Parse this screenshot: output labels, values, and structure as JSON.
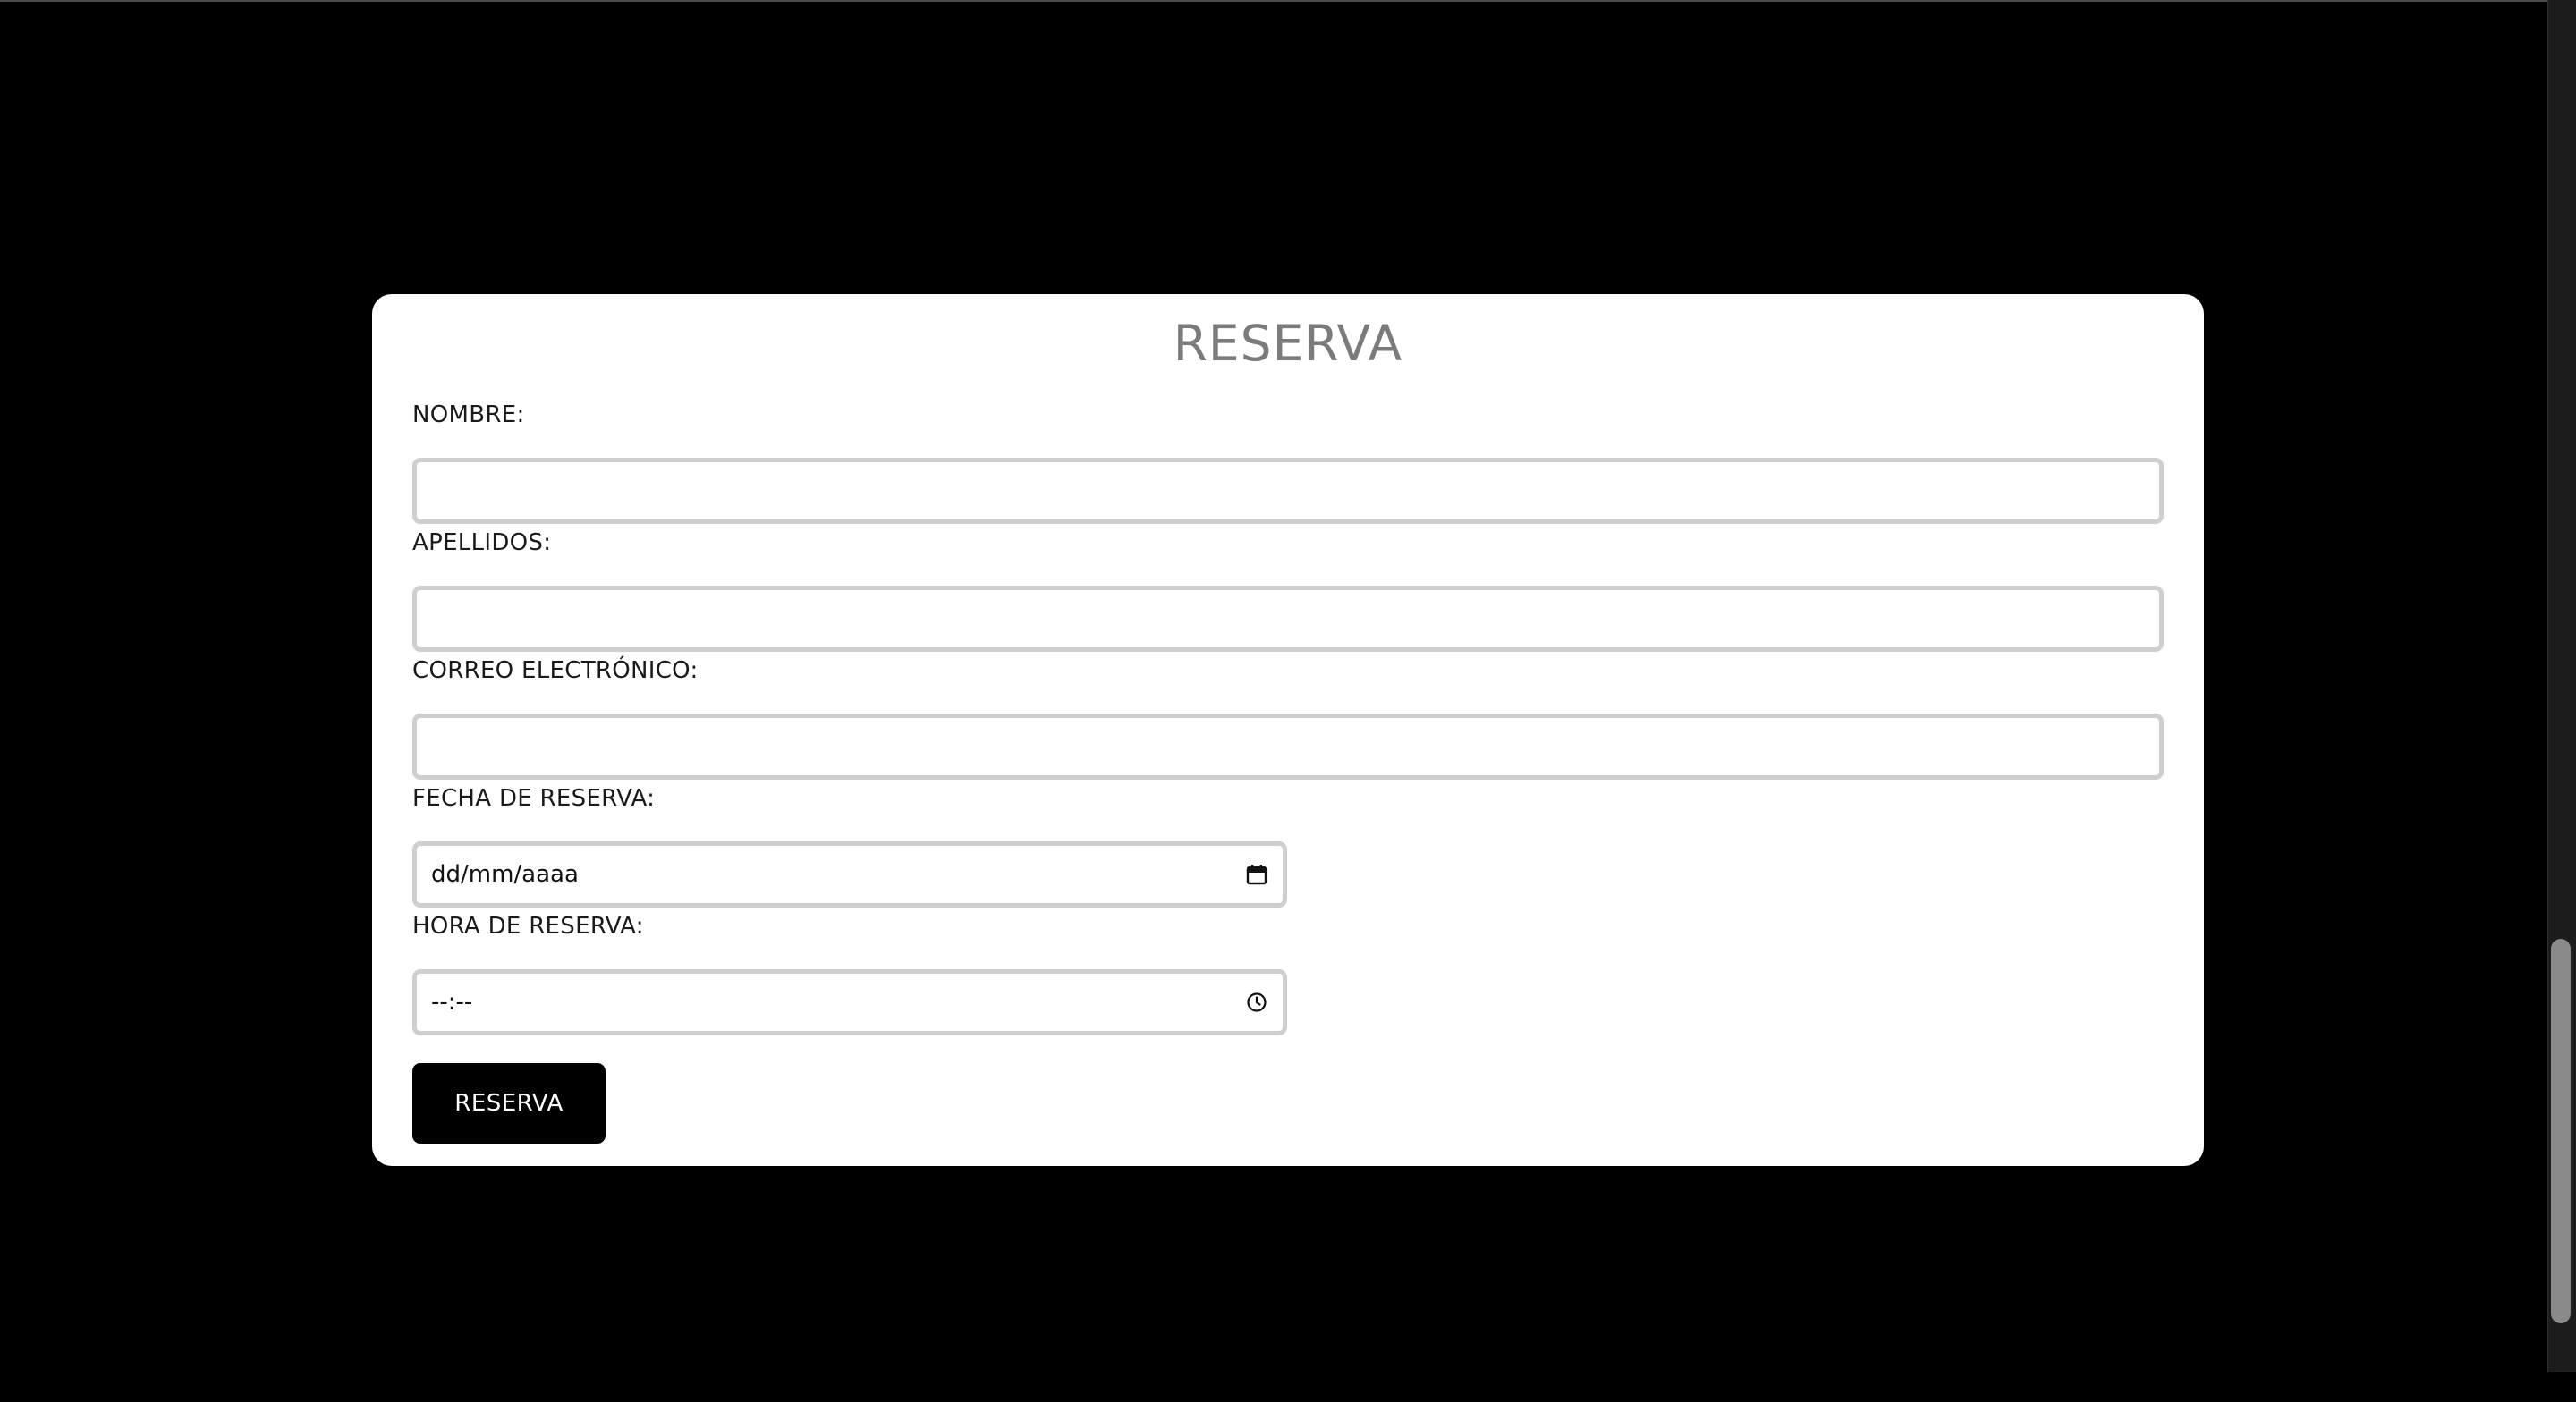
{
  "form": {
    "title": "RESERVA",
    "fields": [
      {
        "label": "NOMBRE:",
        "value": ""
      },
      {
        "label": "APELLIDOS:",
        "value": ""
      },
      {
        "label": "CORREO ELECTRÓNICO:",
        "value": ""
      },
      {
        "label": "FECHA DE RESERVA:",
        "placeholder": "dd/mm/aaaa",
        "icon": "calendar-icon"
      },
      {
        "label": "HORA DE RESERVA:",
        "placeholder": "--:--",
        "icon": "clock-icon"
      }
    ],
    "submit_label": "RESERVA"
  },
  "colors": {
    "page_background": "#000000",
    "card_background": "#ffffff",
    "title_text": "#7b7b7b",
    "field_border": "#cfcfcf",
    "button_background": "#000000",
    "button_text": "#ffffff"
  }
}
